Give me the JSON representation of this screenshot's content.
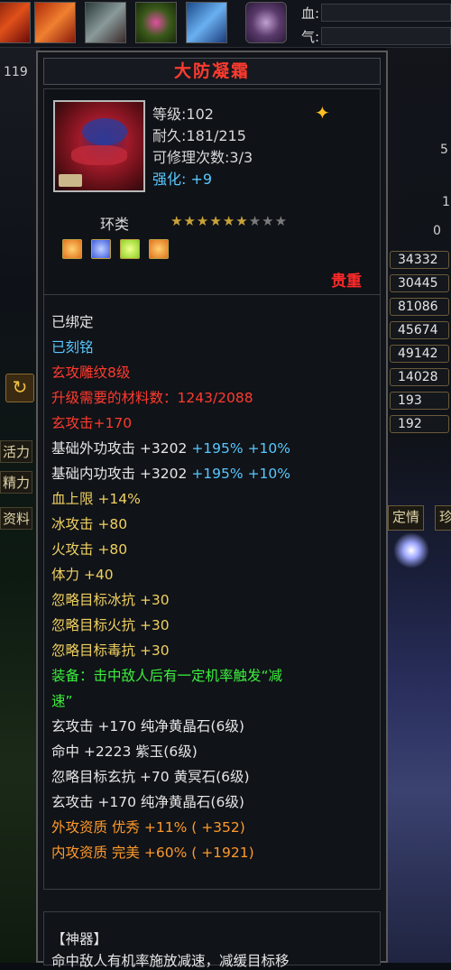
{
  "top_bar": {
    "hp_label": "血:",
    "qi_label": "气:"
  },
  "left_panel": {
    "level": "119",
    "frag1": "活力",
    "frag2": "精力",
    "frag3": "资料"
  },
  "right_panel": {
    "partial_values": [
      "5",
      "1",
      "0"
    ],
    "values": [
      "34332",
      "30445",
      "81086",
      "45674",
      "49142",
      "14028",
      "193",
      "192"
    ],
    "tab1": "定情",
    "tab2": "珍"
  },
  "item": {
    "name": "大防凝霜",
    "level_label": "等级",
    "level": "102",
    "durability_label": "耐久",
    "durability": "181/215",
    "repair_label": "可修理次数",
    "repair": "3/3",
    "enhance_label": "强化",
    "enhance": "+9",
    "category": "环类",
    "stars_filled": 6,
    "stars_total": 9,
    "rarity": "贵重",
    "gem_slots": [
      {
        "icon": "orange-gem-icon",
        "color": "#e0701a"
      },
      {
        "icon": "blue-gem-icon",
        "color": "#3a5adf"
      },
      {
        "icon": "green-gem-icon",
        "color": "#8ad020"
      },
      {
        "icon": "orange-gem-icon",
        "color": "#e0701a"
      }
    ]
  },
  "attributes": [
    {
      "text": "已绑定",
      "color": "white"
    },
    {
      "text": "已刻铭",
      "color": "cyan"
    },
    {
      "text": "玄攻雕纹8级",
      "color": "red"
    },
    {
      "text": "升级需要的材料数：1243/2088",
      "color": "red"
    },
    {
      "text": "玄攻击+170",
      "color": "red"
    },
    {
      "text": "基础外功攻击 +3202",
      "extra1": "+195%",
      "extra2": "+10%",
      "color": "white"
    },
    {
      "text": "基础内功攻击 +3202",
      "extra1": "+195%",
      "extra2": "+10%",
      "color": "white"
    },
    {
      "text": "血上限 +14%",
      "color": "yellow"
    },
    {
      "text": "冰攻击 +80",
      "color": "yellow"
    },
    {
      "text": "火攻击 +80",
      "color": "yellow"
    },
    {
      "text": "体力 +40",
      "color": "yellow"
    },
    {
      "text": "忽略目标冰抗 +30",
      "color": "yellow"
    },
    {
      "text": "忽略目标火抗 +30",
      "color": "yellow"
    },
    {
      "text": "忽略目标毒抗 +30",
      "color": "yellow"
    },
    {
      "text": "装备：击中敌人后有一定机率触发“减",
      "color": "green"
    },
    {
      "text": "速”",
      "color": "green"
    },
    {
      "text": "玄攻击 +170 纯净黄晶石(6级)",
      "color": "white"
    },
    {
      "text": "命中 +2223 紫玉(6级)",
      "color": "white"
    },
    {
      "text": "忽略目标玄抗 +70 黄冥石(6级)",
      "color": "white"
    },
    {
      "text": "玄攻击 +170 纯净黄晶石(6级)",
      "color": "white"
    },
    {
      "text": "外攻资质   优秀 +11% ( +352)",
      "color": "orange"
    },
    {
      "text": "内攻资质   完美 +60% ( +1921)",
      "color": "orange"
    }
  ],
  "footer": {
    "header": "【神器】",
    "text": "命中敌人有机率施放减速，减缓目标移"
  }
}
